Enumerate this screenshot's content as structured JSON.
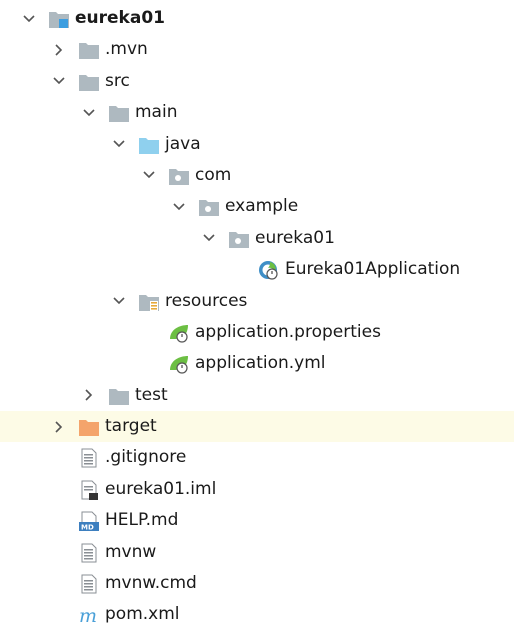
{
  "tree": [
    {
      "label": "eureka01",
      "bold": true,
      "depth": 0,
      "arrow": "down",
      "icon": "module"
    },
    {
      "label": ".mvn",
      "depth": 1,
      "arrow": "right",
      "icon": "folder"
    },
    {
      "label": "src",
      "depth": 1,
      "arrow": "down",
      "icon": "folder"
    },
    {
      "label": "main",
      "depth": 2,
      "arrow": "down",
      "icon": "folder"
    },
    {
      "label": "java",
      "depth": 3,
      "arrow": "down",
      "icon": "folder-source"
    },
    {
      "label": "com",
      "depth": 4,
      "arrow": "down",
      "icon": "package"
    },
    {
      "label": "example",
      "depth": 5,
      "arrow": "down",
      "icon": "package"
    },
    {
      "label": "eureka01",
      "depth": 6,
      "arrow": "down",
      "icon": "package"
    },
    {
      "label": "Eureka01Application",
      "depth": 7,
      "arrow": "none",
      "icon": "spring-class"
    },
    {
      "label": "resources",
      "depth": 3,
      "arrow": "down",
      "icon": "folder-resources"
    },
    {
      "label": "application.properties",
      "depth": 4,
      "arrow": "none",
      "icon": "spring-config"
    },
    {
      "label": "application.yml",
      "depth": 4,
      "arrow": "none",
      "icon": "spring-config"
    },
    {
      "label": "test",
      "depth": 2,
      "arrow": "right",
      "icon": "folder"
    },
    {
      "label": "target",
      "depth": 1,
      "arrow": "right",
      "icon": "folder-excluded",
      "selected": true
    },
    {
      "label": ".gitignore",
      "depth": 1,
      "arrow": "none",
      "icon": "text-file"
    },
    {
      "label": "eureka01.iml",
      "depth": 1,
      "arrow": "none",
      "icon": "iml-file"
    },
    {
      "label": "HELP.md",
      "depth": 1,
      "arrow": "none",
      "icon": "markdown-file"
    },
    {
      "label": "mvnw",
      "depth": 1,
      "arrow": "none",
      "icon": "text-file"
    },
    {
      "label": "mvnw.cmd",
      "depth": 1,
      "arrow": "none",
      "icon": "text-file"
    },
    {
      "label": "pom.xml",
      "depth": 1,
      "arrow": "none",
      "icon": "maven-file"
    }
  ],
  "colors": {
    "folder": "#aeb9c0",
    "source_folder": "#8fd0ee",
    "excluded_folder": "#f4a46b",
    "spring": "#6cbf43",
    "selected_row": "#fdfbe6"
  }
}
